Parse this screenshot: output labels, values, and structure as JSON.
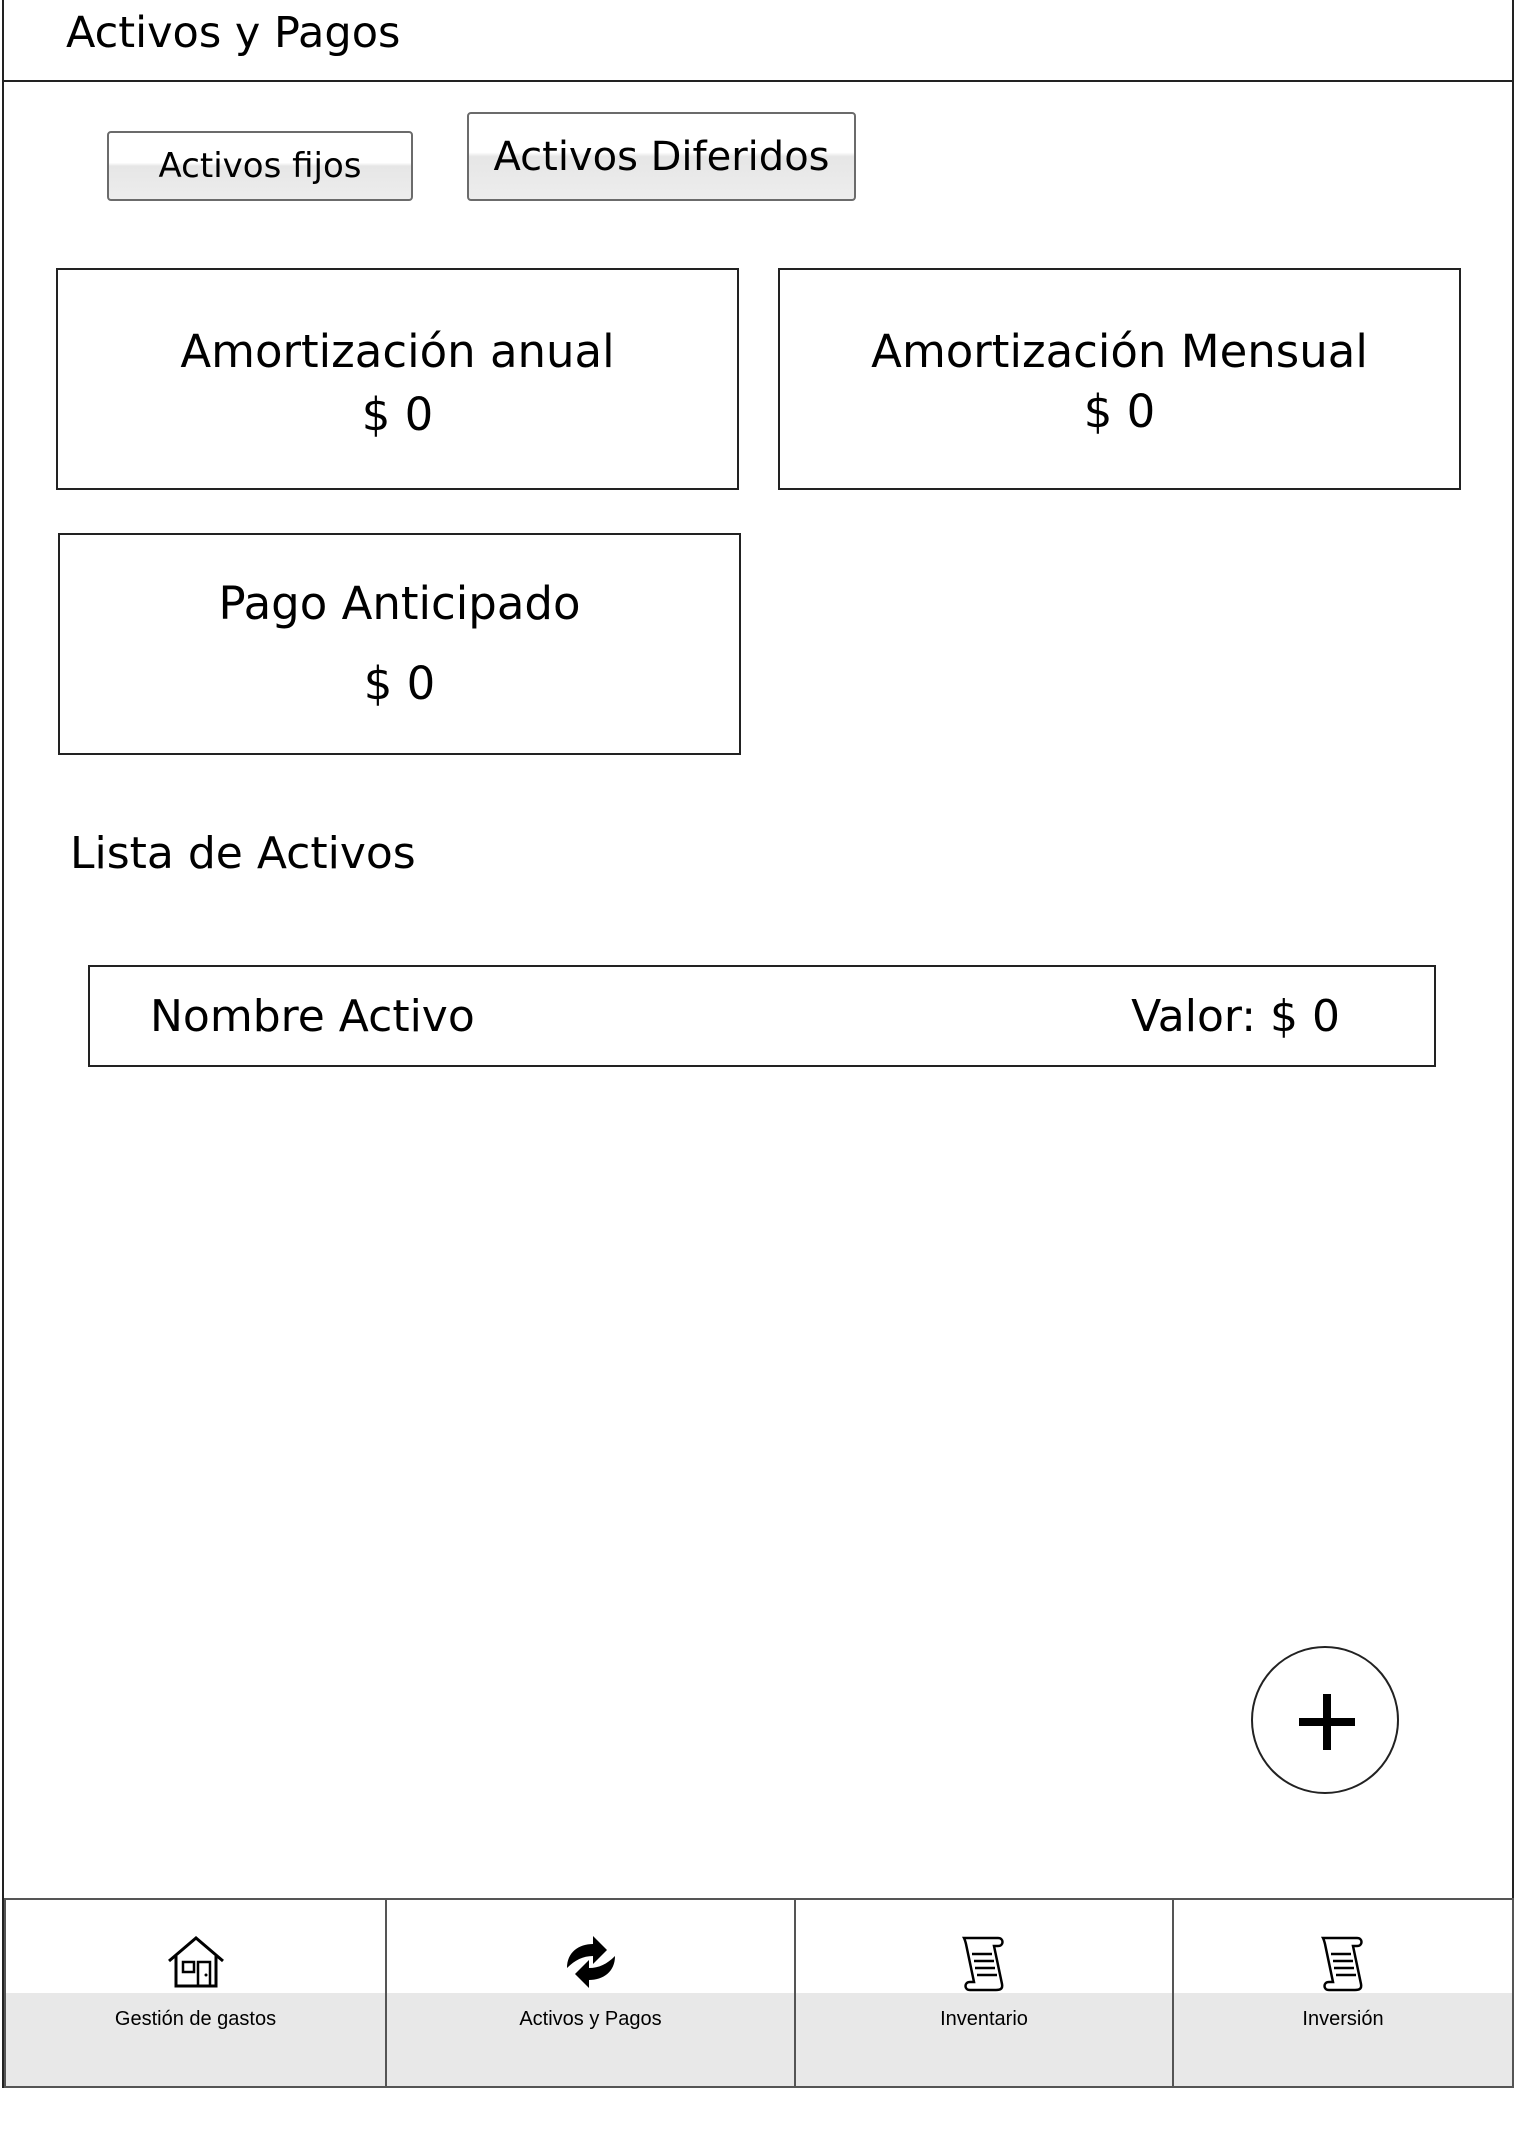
{
  "header": {
    "title": "Activos y Pagos"
  },
  "tabs": {
    "fijos_label": "Activos fijos",
    "diferidos_label": "Activos Diferidos"
  },
  "cards": {
    "amortizacion_anual": {
      "label": "Amortización anual",
      "value": "$ 0"
    },
    "amortizacion_mensual": {
      "label": "Amortización Mensual",
      "value": "$ 0"
    },
    "pago_anticipado": {
      "label": "Pago Anticipado",
      "value": "$ 0"
    }
  },
  "list": {
    "title": "Lista de Activos",
    "items": [
      {
        "name": "Nombre Activo",
        "value": "Valor: $ 0"
      }
    ]
  },
  "fab": {
    "icon": "plus-icon"
  },
  "bottom_nav": {
    "items": [
      {
        "label": "Gestión de gastos",
        "icon": "house-icon"
      },
      {
        "label": "Activos y Pagos",
        "icon": "sync-arrows-icon"
      },
      {
        "label": "Inventario",
        "icon": "scroll-icon"
      },
      {
        "label": "Inversión",
        "icon": "scroll-icon"
      }
    ]
  }
}
